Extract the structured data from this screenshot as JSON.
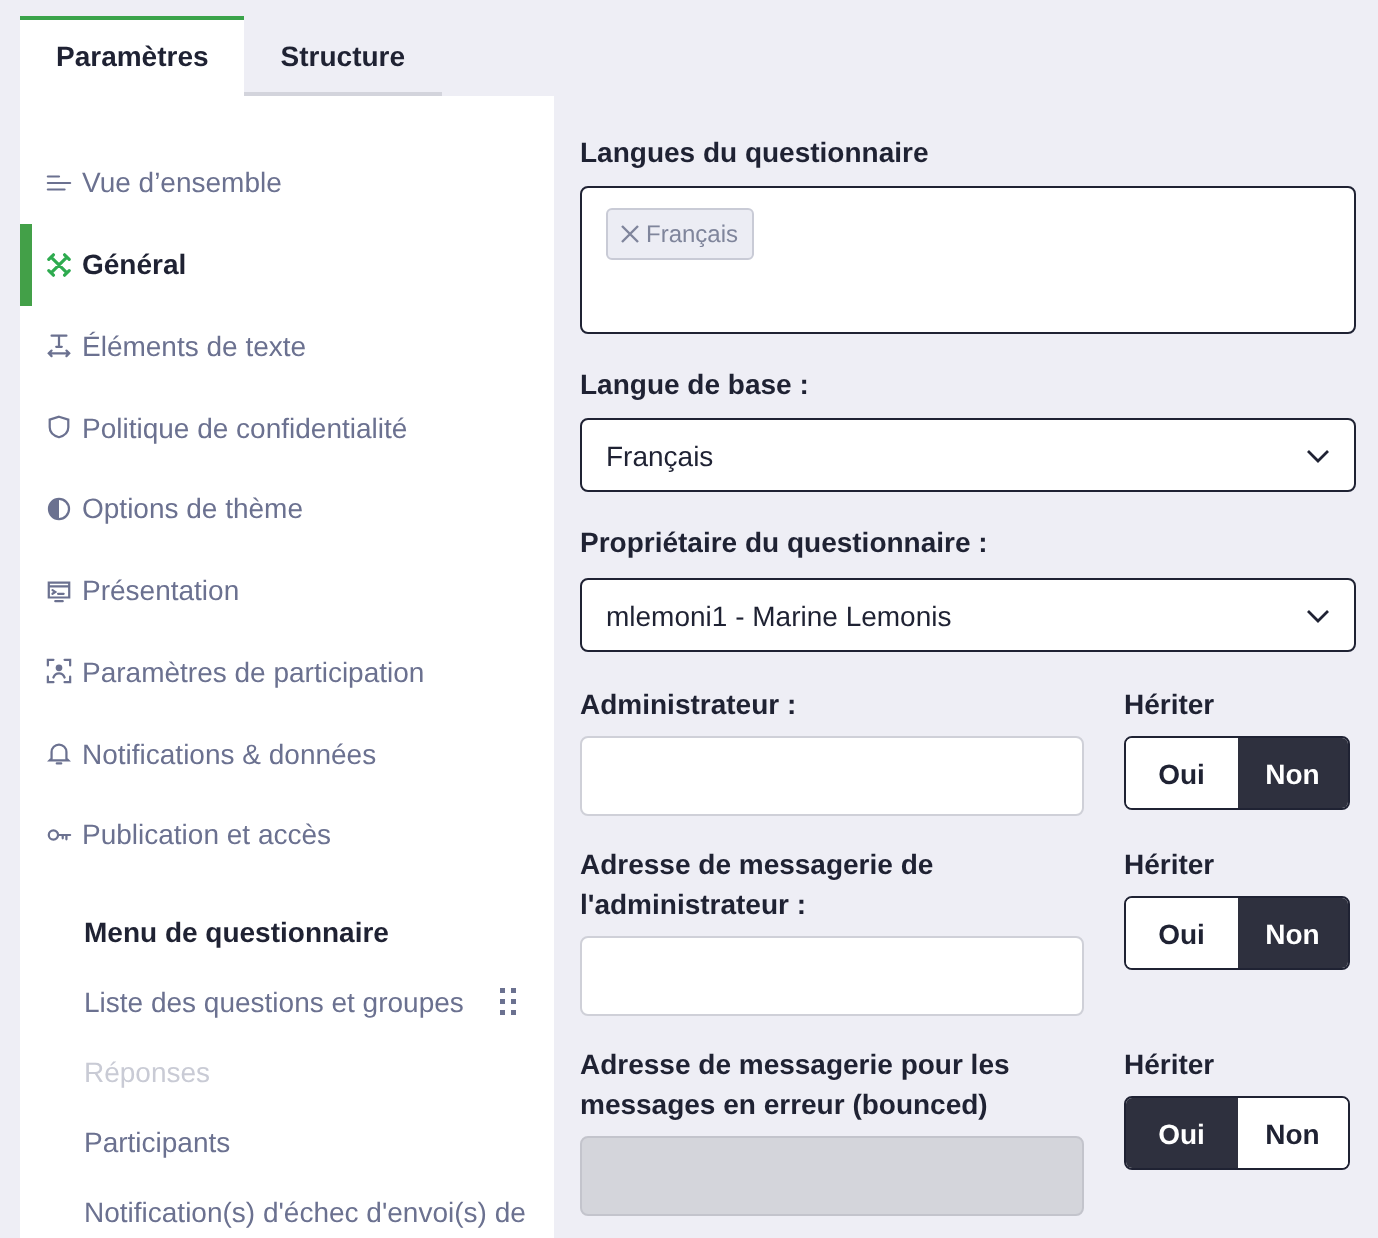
{
  "tabs": [
    {
      "label": "Paramètres",
      "selected": true
    },
    {
      "label": "Structure",
      "selected": false
    }
  ],
  "sidebar": {
    "items": [
      {
        "label": "Vue d’ensemble",
        "selected": false
      },
      {
        "label": "Général",
        "selected": true
      },
      {
        "label": "Éléments de texte",
        "selected": false
      },
      {
        "label": "Politique de confidentialité",
        "selected": false
      },
      {
        "label": "Options de thème",
        "selected": false
      },
      {
        "label": "Présentation",
        "selected": false
      },
      {
        "label": "Paramètres de participation",
        "selected": false
      },
      {
        "label": "Notifications & données",
        "selected": false
      },
      {
        "label": "Publication et accès",
        "selected": false
      }
    ]
  },
  "questionnaire_menu": {
    "title": "Menu de questionnaire",
    "items": [
      {
        "label": "Liste des questions et groupes",
        "disabled": false,
        "drag_handle": true
      },
      {
        "label": "Réponses",
        "disabled": true,
        "drag_handle": false
      },
      {
        "label": "Participants",
        "disabled": false,
        "drag_handle": false
      },
      {
        "label": "Notification(s) d'échec d'envoi(s) de",
        "disabled": false,
        "drag_handle": false
      }
    ]
  },
  "form": {
    "languages": {
      "label": "Langues du questionnaire",
      "chips": [
        {
          "label": "Français"
        }
      ]
    },
    "base_language": {
      "label": "Langue de base :",
      "value": "Français"
    },
    "owner": {
      "label": "Propriétaire du questionnaire :",
      "value": "mlemoni1 - Marine Lemonis"
    },
    "fields": [
      {
        "label": "Administrateur :",
        "disabled": false,
        "inherit": {
          "label": "Hériter",
          "options": [
            {
              "label": "Oui",
              "selected": false
            },
            {
              "label": "Non",
              "selected": true
            }
          ]
        }
      },
      {
        "label": "Adresse de messagerie de l'administrateur :",
        "disabled": false,
        "inherit": {
          "label": "Hériter",
          "options": [
            {
              "label": "Oui",
              "selected": false
            },
            {
              "label": "Non",
              "selected": true
            }
          ]
        }
      },
      {
        "label": "Adresse de messagerie pour les messages en erreur (bounced)",
        "disabled": true,
        "inherit": {
          "label": "Hériter",
          "options": [
            {
              "label": "Oui",
              "selected": true
            },
            {
              "label": "Non",
              "selected": false
            }
          ]
        }
      }
    ]
  }
}
